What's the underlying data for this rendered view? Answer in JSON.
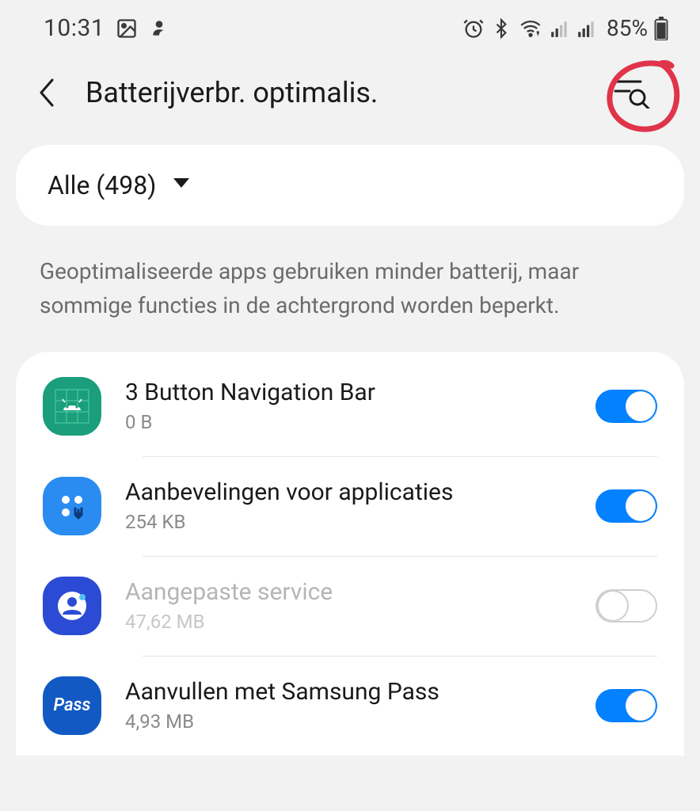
{
  "status": {
    "time": "10:31",
    "battery_pct": "85%"
  },
  "header": {
    "title": "Batterijverbr. optimalis."
  },
  "filter": {
    "label": "Alle (498)"
  },
  "description": "Geoptimaliseerde apps gebruiken minder batterij, maar sommige functies in de achtergrond worden beperkt.",
  "apps": [
    {
      "name": "3 Button Navigation Bar",
      "size": "0 B",
      "enabled": true,
      "on": true,
      "icon": "android"
    },
    {
      "name": "Aanbevelingen voor applicaties",
      "size": "254 KB",
      "enabled": true,
      "on": true,
      "icon": "grid"
    },
    {
      "name": "Aangepaste service",
      "size": "47,62 MB",
      "enabled": false,
      "on": false,
      "icon": "person"
    },
    {
      "name": "Aanvullen met Samsung Pass",
      "size": "4,93 MB",
      "enabled": true,
      "on": true,
      "icon": "pass"
    }
  ]
}
